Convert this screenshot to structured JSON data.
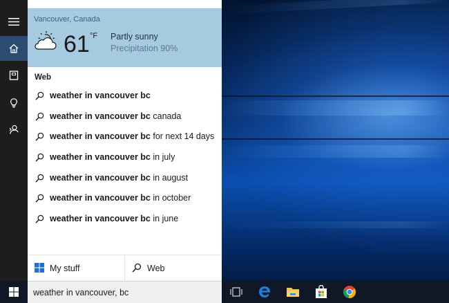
{
  "weather": {
    "location": "Vancouver, Canada",
    "temperature": "61",
    "unit": "°F",
    "condition": "Partly sunny",
    "precipitation": "Precipitation 90%"
  },
  "web_heading": "Web",
  "suggestions": [
    {
      "bold": "weather in vancouver bc",
      "rest": ""
    },
    {
      "bold": "weather in vancouver bc",
      "rest": " canada"
    },
    {
      "bold": "weather in vancouver bc",
      "rest": " for next 14 days"
    },
    {
      "bold": "weather in vancouver bc",
      "rest": " in july"
    },
    {
      "bold": "weather in vancouver bc",
      "rest": " in august"
    },
    {
      "bold": "weather in vancouver bc",
      "rest": " in october"
    },
    {
      "bold": "weather in vancouver bc",
      "rest": " in june"
    }
  ],
  "bottom": {
    "my_stuff_label": "My stuff",
    "web_label": "Web"
  },
  "search": {
    "value": "weather in vancouver, bc"
  },
  "rail": [
    "menu-icon",
    "home-icon",
    "notebook-icon",
    "lightbulb-icon",
    "feedback-icon"
  ],
  "taskbar_icons": [
    "task-view-icon",
    "edge-icon",
    "file-explorer-icon",
    "store-icon",
    "chrome-icon"
  ],
  "colors": {
    "weather_bg": "#a6cbe0",
    "rail_bg": "#1d1d1d",
    "rail_active": "#2b4b6f",
    "taskbar_bg": "#101828",
    "edge_blue": "#1e7fd8"
  }
}
